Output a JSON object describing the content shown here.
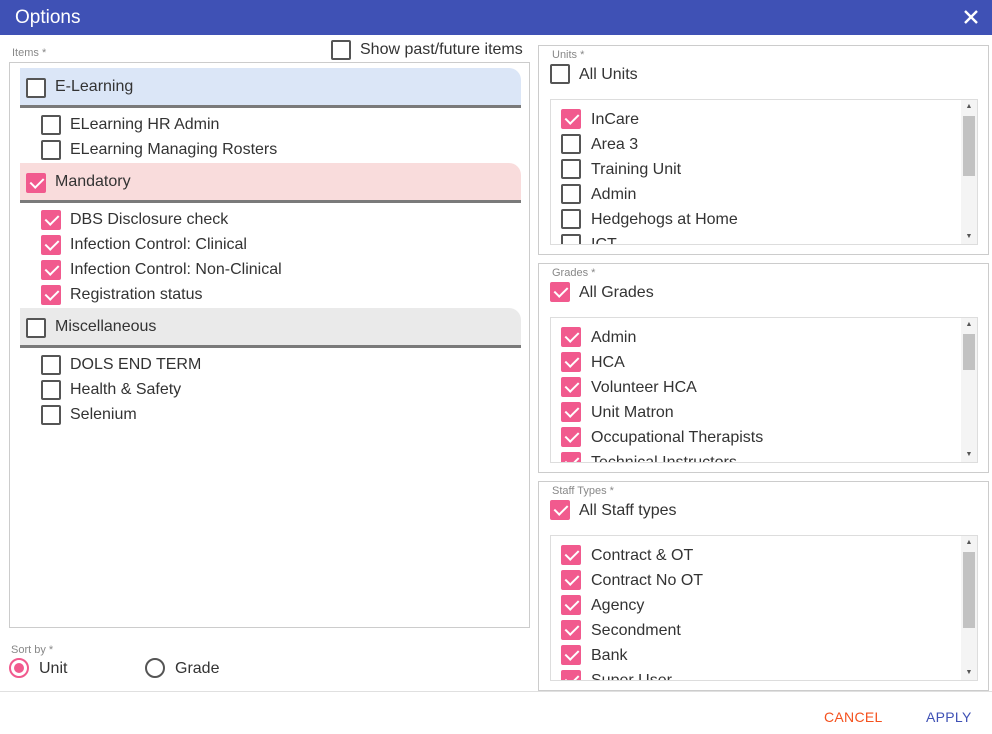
{
  "title": "Options",
  "items_label": "Items *",
  "show_past_future": {
    "label": "Show past/future items",
    "checked": false
  },
  "groups": [
    {
      "label": "E-Learning",
      "checked": false,
      "color": "#dbe6f7",
      "items": [
        {
          "label": "ELearning HR Admin",
          "checked": false
        },
        {
          "label": "ELearning Managing Rosters",
          "checked": false
        }
      ]
    },
    {
      "label": "Mandatory",
      "checked": true,
      "color": "#f9dcdc",
      "items": [
        {
          "label": "DBS Disclosure check",
          "checked": true
        },
        {
          "label": "Infection Control: Clinical",
          "checked": true
        },
        {
          "label": "Infection Control: Non-Clinical",
          "checked": true
        },
        {
          "label": "Registration status",
          "checked": true
        }
      ]
    },
    {
      "label": "Miscellaneous",
      "checked": false,
      "color": "#eaeaea",
      "items": [
        {
          "label": "DOLS END TERM",
          "checked": false
        },
        {
          "label": "Health & Safety",
          "checked": false
        },
        {
          "label": "Selenium",
          "checked": false
        }
      ]
    }
  ],
  "units": {
    "label": "Units *",
    "all_label": "All Units",
    "all_checked": false,
    "items": [
      {
        "label": "InCare",
        "checked": true
      },
      {
        "label": "Area 3",
        "checked": false
      },
      {
        "label": "Training Unit",
        "checked": false
      },
      {
        "label": "Admin",
        "checked": false
      },
      {
        "label": "Hedgehogs at Home",
        "checked": false
      },
      {
        "label": "ICT",
        "checked": false
      }
    ]
  },
  "grades": {
    "label": "Grades *",
    "all_label": "All Grades",
    "all_checked": true,
    "items": [
      {
        "label": "Admin",
        "checked": true
      },
      {
        "label": "HCA",
        "checked": true
      },
      {
        "label": "Volunteer HCA",
        "checked": true
      },
      {
        "label": "Unit Matron",
        "checked": true
      },
      {
        "label": "Occupational Therapists",
        "checked": true
      },
      {
        "label": "Technical Instructors",
        "checked": true
      }
    ]
  },
  "staff_types": {
    "label": "Staff Types *",
    "all_label": "All Staff types",
    "all_checked": true,
    "items": [
      {
        "label": "Contract & OT",
        "checked": true
      },
      {
        "label": "Contract No OT",
        "checked": true
      },
      {
        "label": "Agency",
        "checked": true
      },
      {
        "label": "Secondment",
        "checked": true
      },
      {
        "label": "Bank",
        "checked": true
      },
      {
        "label": "Super User",
        "checked": true
      }
    ]
  },
  "sort_by": {
    "label": "Sort by *",
    "options": [
      {
        "label": "Unit",
        "checked": true
      },
      {
        "label": "Grade",
        "checked": false
      }
    ]
  },
  "buttons": {
    "cancel": "CANCEL",
    "apply": "APPLY"
  },
  "colors": {
    "header": "#3f51b5",
    "accent": "#f15a8e",
    "cancel": "#f4511e",
    "apply": "#3f51b5"
  }
}
